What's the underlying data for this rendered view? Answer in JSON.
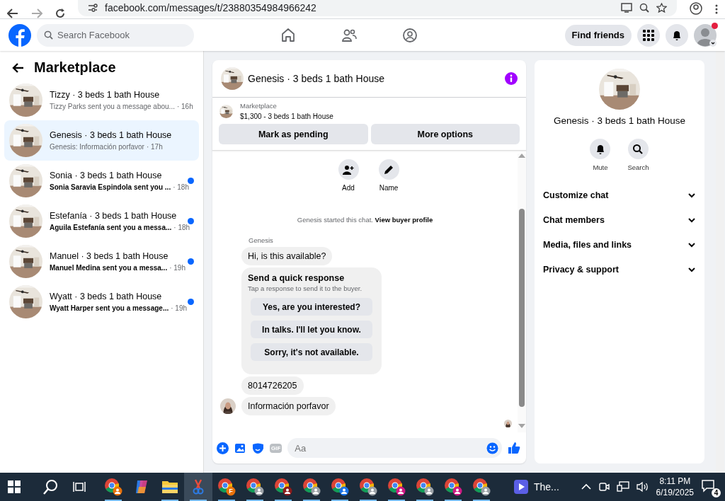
{
  "browser": {
    "url": "facebook.com/messages/t/23880354984966242"
  },
  "header": {
    "search_placeholder": "Search Facebook",
    "find_friends": "Find friends",
    "avatar_alert": true
  },
  "sidebar": {
    "title": "Marketplace",
    "conversations": [
      {
        "title": "Tizzy · 3 beds 1 bath House",
        "preview": "Tizzy Parks sent you a message abou...",
        "time": "· 16h",
        "selected": false,
        "unread": false
      },
      {
        "title": "Genesis · 3 beds 1 bath House",
        "preview": "Genesis: Información porfavor",
        "time": "· 17h",
        "selected": true,
        "unread": false
      },
      {
        "title": "Sonia · 3 beds 1 bath House",
        "preview": "Sonia Saravia Espindola sent you ...",
        "time": "· 18h",
        "selected": false,
        "unread": true
      },
      {
        "title": "Estefanía · 3 beds 1 bath House",
        "preview": "Aguila Estefanía sent you a messa...",
        "time": "· 18h",
        "selected": false,
        "unread": true
      },
      {
        "title": "Manuel · 3 beds 1 bath House",
        "preview": "Manuel Medina sent you a messa...",
        "time": "· 19h",
        "selected": false,
        "unread": true
      },
      {
        "title": "Wyatt · 3 beds 1 bath House",
        "preview": "Wyatt Harper sent you a message...",
        "time": "· 19h",
        "selected": false,
        "unread": true
      }
    ]
  },
  "chat": {
    "title": "Genesis · 3 beds 1 bath House",
    "listing": {
      "label": "Marketplace",
      "summary": "$1,300 - 3 beds 1 bath House"
    },
    "actions": [
      "Mark as pending",
      "More options"
    ],
    "quick_actions": [
      {
        "label": "Add",
        "kind": "add-person"
      },
      {
        "label": "Name",
        "kind": "edit"
      }
    ],
    "notice": {
      "text": "Genesis started this chat.",
      "link": "View buyer profile"
    },
    "sender": "Genesis",
    "messages": [
      {
        "kind": "text",
        "text": "Hi, is this available?"
      },
      {
        "kind": "quick_response",
        "title": "Send a quick response",
        "subtitle": "Tap a response to send it to the buyer.",
        "options": [
          "Yes, are you interested?",
          "In talks. I'll let you know.",
          "Sorry, it's not available."
        ]
      },
      {
        "kind": "text",
        "text": "8014726205"
      },
      {
        "kind": "text",
        "text": "Información porfavor"
      }
    ],
    "composer": {
      "gif_label": "GIF",
      "placeholder": "Aa"
    }
  },
  "details": {
    "title": "Genesis · 3 beds 1 bath House",
    "actions": [
      {
        "label": "Mute",
        "kind": "bell"
      },
      {
        "label": "Search",
        "kind": "search"
      }
    ],
    "sections": [
      "Customize chat",
      "Chat members",
      "Media, files and links",
      "Privacy & support"
    ]
  },
  "taskbar": {
    "apps": [
      {
        "kind": "chrome",
        "color": "#e8710a",
        "open": true,
        "selected": false
      },
      {
        "kind": "copilot",
        "open": false,
        "selected": false
      },
      {
        "kind": "folder",
        "open": true,
        "selected": false
      },
      {
        "kind": "snip",
        "open": true,
        "selected": true
      },
      {
        "kind": "chrome",
        "color": "#e8710a",
        "letter": "F",
        "open": true,
        "selected": false
      },
      {
        "kind": "chrome",
        "color": "#9aa0a6",
        "open": true,
        "selected": false
      },
      {
        "kind": "chrome",
        "color": "#8b1a1a",
        "open": true,
        "selected": false
      },
      {
        "kind": "chrome",
        "color": "#9aa0a6",
        "open": true,
        "selected": false
      },
      {
        "kind": "chrome",
        "color": "#1a73e8",
        "open": true,
        "selected": false
      },
      {
        "kind": "chrome",
        "color": "#9aa0a6",
        "open": true,
        "selected": false
      },
      {
        "kind": "chrome",
        "color": "#d01884",
        "open": true,
        "selected": false
      },
      {
        "kind": "chrome",
        "color": "#9aa0a6",
        "open": true,
        "selected": false
      },
      {
        "kind": "chrome",
        "color": "#d01884",
        "open": true,
        "selected": false
      },
      {
        "kind": "chrome",
        "color": "#9aa0a6",
        "open": true,
        "selected": false
      }
    ],
    "window_label": "The...",
    "time": "8:11 PM",
    "date": "6/19/2025",
    "notifications": "4"
  }
}
